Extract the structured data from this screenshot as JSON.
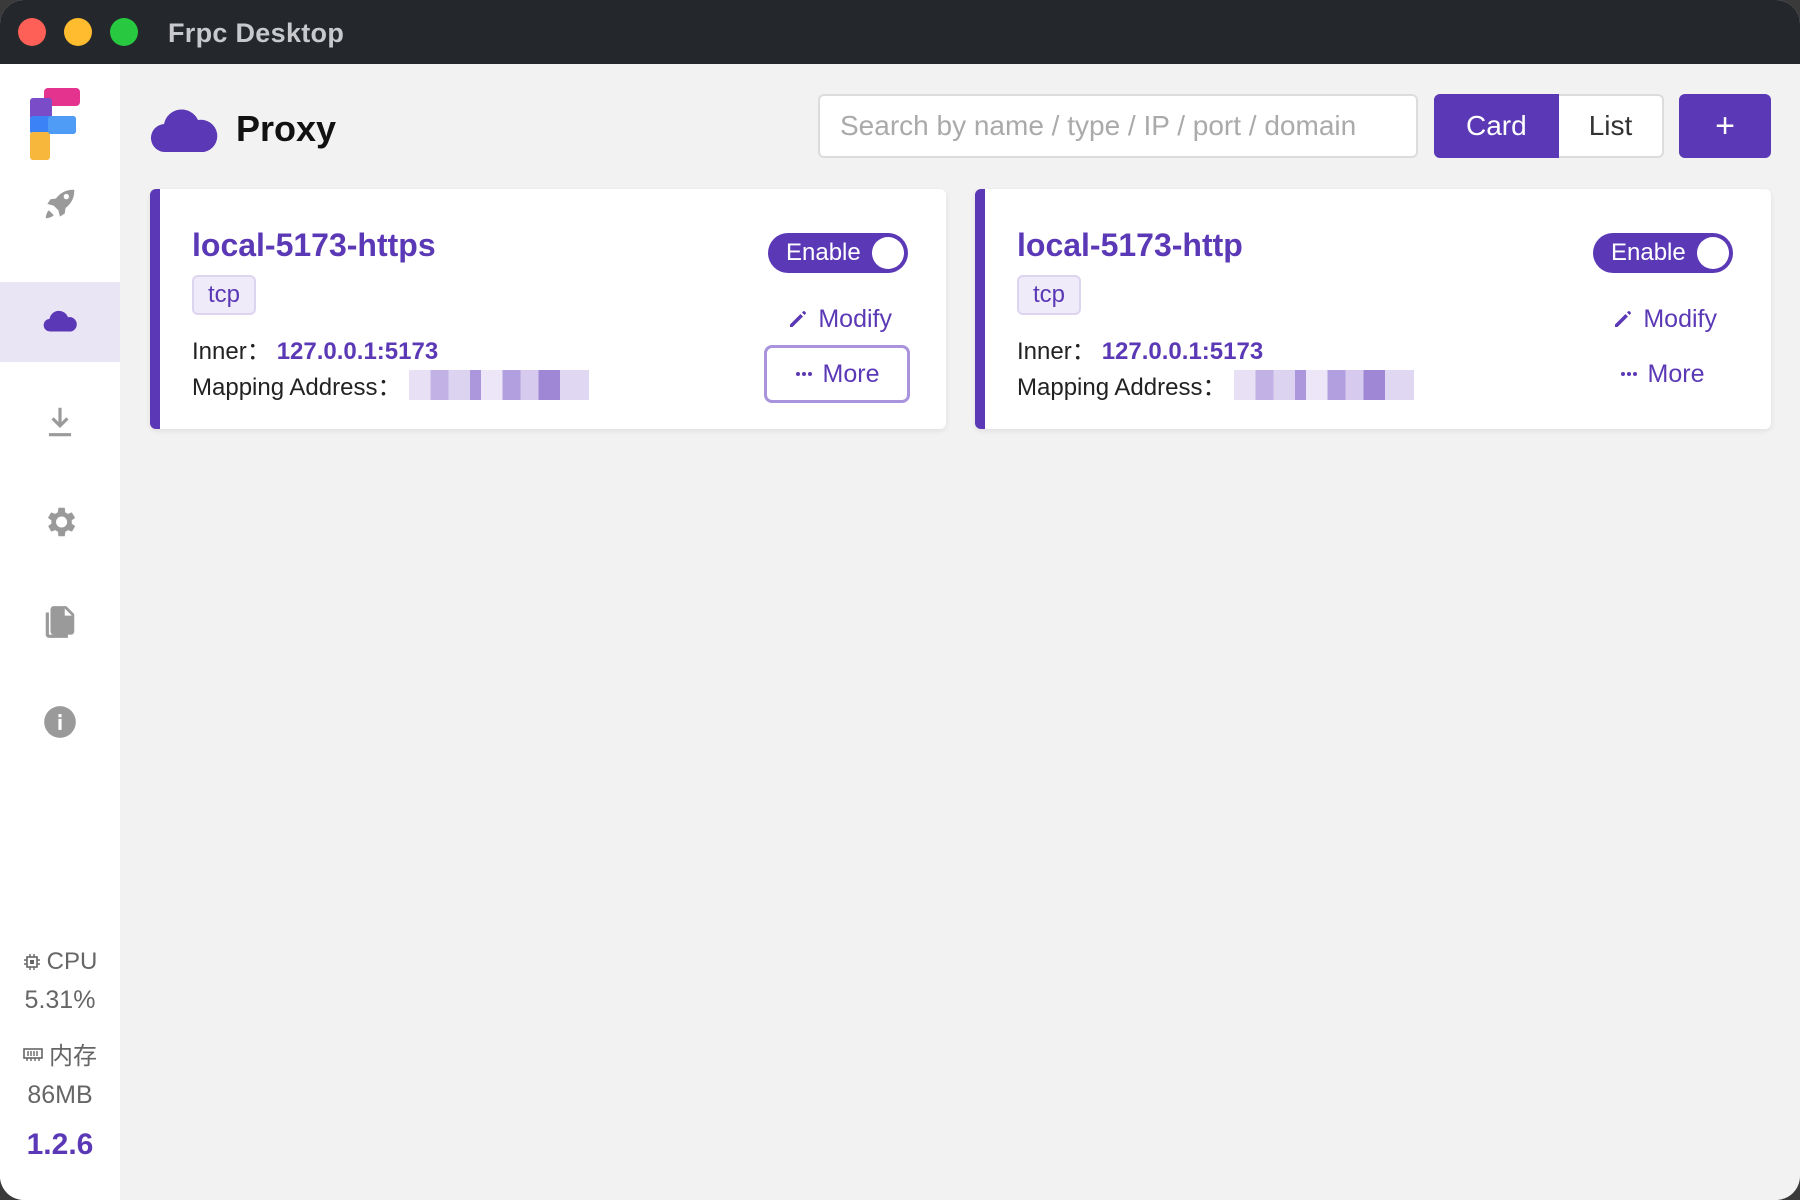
{
  "window": {
    "title": "Frpc Desktop"
  },
  "sidebar": {
    "items": [
      {
        "name": "rocket",
        "active": false
      },
      {
        "name": "cloud",
        "active": true
      },
      {
        "name": "download",
        "active": false
      },
      {
        "name": "gear",
        "active": false
      },
      {
        "name": "files",
        "active": false
      },
      {
        "name": "info",
        "active": false
      }
    ],
    "cpu_label": "CPU",
    "cpu_value": "5.31%",
    "mem_label": "内存",
    "mem_value": "86MB",
    "version": "1.2.6"
  },
  "header": {
    "title": "Proxy",
    "search_placeholder": "Search by name / type / IP / port / domain",
    "view_card": "Card",
    "view_list": "List",
    "add_label": "+"
  },
  "cards": [
    {
      "name": "local-5173-https",
      "type": "tcp",
      "inner_label": "Inner：",
      "inner_value": "127.0.0.1:5173",
      "mapping_label": "Mapping Address：",
      "toggle_label": "Enable",
      "modify_label": "Modify",
      "more_label": "More"
    },
    {
      "name": "local-5173-http",
      "type": "tcp",
      "inner_label": "Inner：",
      "inner_value": "127.0.0.1:5173",
      "mapping_label": "Mapping Address：",
      "toggle_label": "Enable",
      "modify_label": "Modify",
      "more_label": "More"
    }
  ],
  "colors": {
    "accent": "#5b39b6",
    "titlebar": "#24272c",
    "background": "#f2f2f2"
  }
}
